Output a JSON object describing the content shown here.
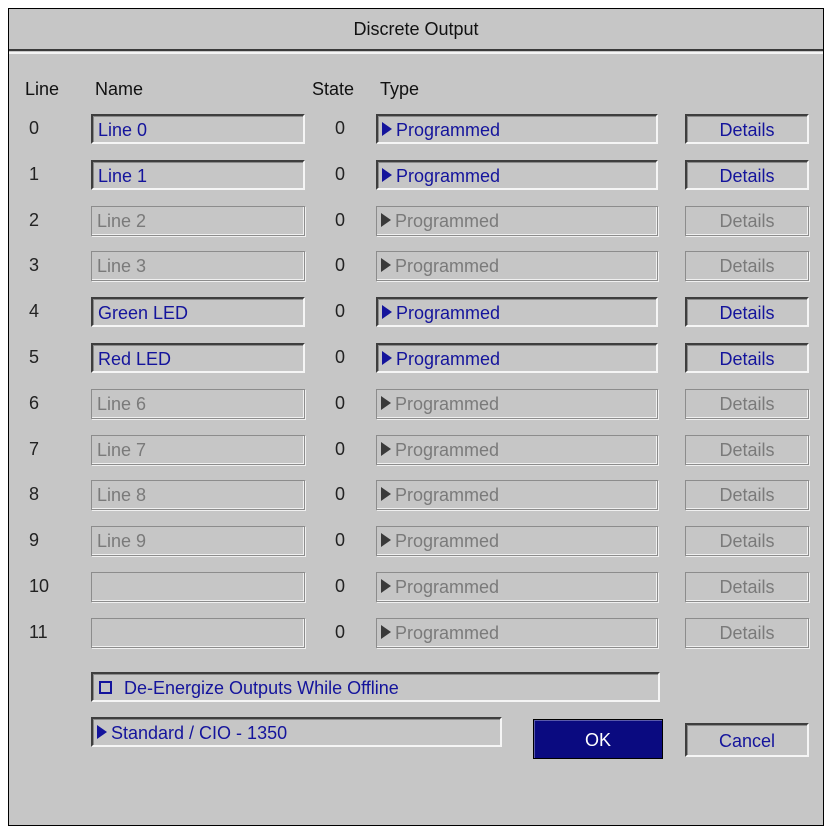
{
  "dialog": {
    "title": "Discrete Output",
    "headers": {
      "line": "Line",
      "name": "Name",
      "state": "State",
      "type": "Type"
    },
    "rows": [
      {
        "line": "0",
        "name": "Line 0",
        "state": "0",
        "type": "Programmed",
        "details": "Details",
        "enabled": true
      },
      {
        "line": "1",
        "name": "Line 1",
        "state": "0",
        "type": "Programmed",
        "details": "Details",
        "enabled": true
      },
      {
        "line": "2",
        "name": "Line 2",
        "state": "0",
        "type": "Programmed",
        "details": "Details",
        "enabled": false
      },
      {
        "line": "3",
        "name": "Line 3",
        "state": "0",
        "type": "Programmed",
        "details": "Details",
        "enabled": false
      },
      {
        "line": "4",
        "name": "Green LED",
        "state": "0",
        "type": "Programmed",
        "details": "Details",
        "enabled": true
      },
      {
        "line": "5",
        "name": "Red LED",
        "state": "0",
        "type": "Programmed",
        "details": "Details",
        "enabled": true
      },
      {
        "line": "6",
        "name": "Line 6",
        "state": "0",
        "type": "Programmed",
        "details": "Details",
        "enabled": false
      },
      {
        "line": "7",
        "name": "Line 7",
        "state": "0",
        "type": "Programmed",
        "details": "Details",
        "enabled": false
      },
      {
        "line": "8",
        "name": "Line 8",
        "state": "0",
        "type": "Programmed",
        "details": "Details",
        "enabled": false
      },
      {
        "line": "9",
        "name": "Line 9",
        "state": "0",
        "type": "Programmed",
        "details": "Details",
        "enabled": false
      },
      {
        "line": "10",
        "name": "",
        "state": "0",
        "type": "Programmed",
        "details": "Details",
        "enabled": false
      },
      {
        "line": "11",
        "name": "",
        "state": "0",
        "type": "Programmed",
        "details": "Details",
        "enabled": false
      }
    ],
    "deenergize_label": "De-Energize Outputs While Offline",
    "deenergize_checked": false,
    "standard_label": "Standard / CIO - 1350",
    "ok_label": "OK",
    "cancel_label": "Cancel"
  },
  "colors": {
    "dialog_bg": "#c6c6c6",
    "enabled_text": "#14149c",
    "disabled_text": "#7a7a7a",
    "ok_bg": "#0a0a80"
  }
}
